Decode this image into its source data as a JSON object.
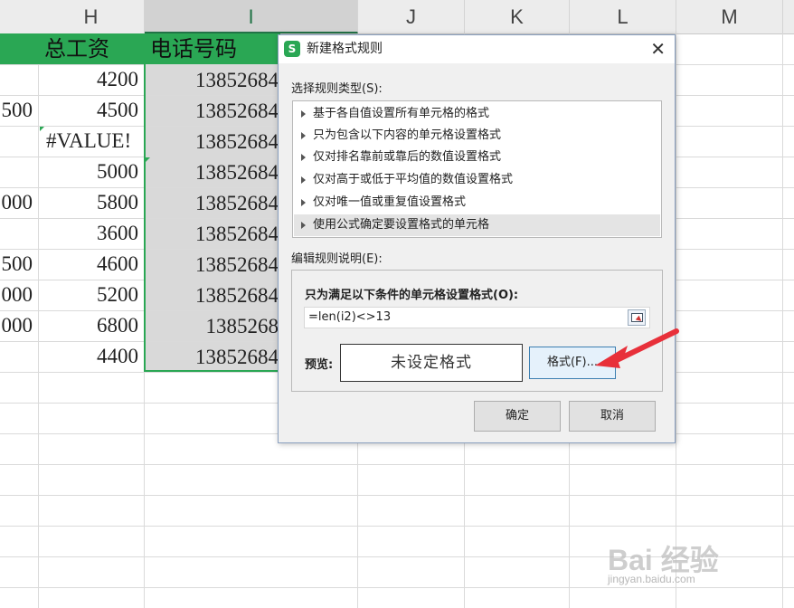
{
  "sheet": {
    "columns": [
      "H",
      "I",
      "J",
      "K",
      "L",
      "M"
    ],
    "header_row": {
      "total_wage": "总工资",
      "phone": "电话号码"
    },
    "rows": [
      {
        "g": "",
        "h": "4200",
        "i": "13852684"
      },
      {
        "g": "500",
        "h": "4500",
        "i": "13852684"
      },
      {
        "g": "",
        "h": "#VALUE!",
        "i": "13852684"
      },
      {
        "g": "",
        "h": "5000",
        "i": "13852684"
      },
      {
        "g": "000",
        "h": "5800",
        "i": "13852684"
      },
      {
        "g": "",
        "h": "3600",
        "i": "13852684"
      },
      {
        "g": "500",
        "h": "4600",
        "i": "13852684"
      },
      {
        "g": "000",
        "h": "5200",
        "i": "13852684"
      },
      {
        "g": "000",
        "h": "6800",
        "i": "1385268"
      },
      {
        "g": "",
        "h": "4400",
        "i": "13852684"
      }
    ],
    "accent_color": "#2aa754"
  },
  "dialog": {
    "title": "新建格式规则",
    "rule_type_label": "选择规则类型(S):",
    "rule_types": [
      "基于各自值设置所有单元格的格式",
      "只为包含以下内容的单元格设置格式",
      "仅对排名靠前或靠后的数值设置格式",
      "仅对高于或低于平均值的数值设置格式",
      "仅对唯一值或重复值设置格式",
      "使用公式确定要设置格式的单元格"
    ],
    "selected_rule_index": 5,
    "edit_desc_label": "编辑规则说明(E):",
    "condition_label": "只为满足以下条件的单元格设置格式(O):",
    "formula_value": "=len(i2)<>13",
    "preview_label": "预览:",
    "preview_text": "未设定格式",
    "format_button": "格式(F)...",
    "ok_button": "确定",
    "cancel_button": "取消"
  },
  "watermark": {
    "brand": "Bai 经验",
    "url": "jingyan.baidu.com"
  },
  "annotation_color": "#e8303a"
}
